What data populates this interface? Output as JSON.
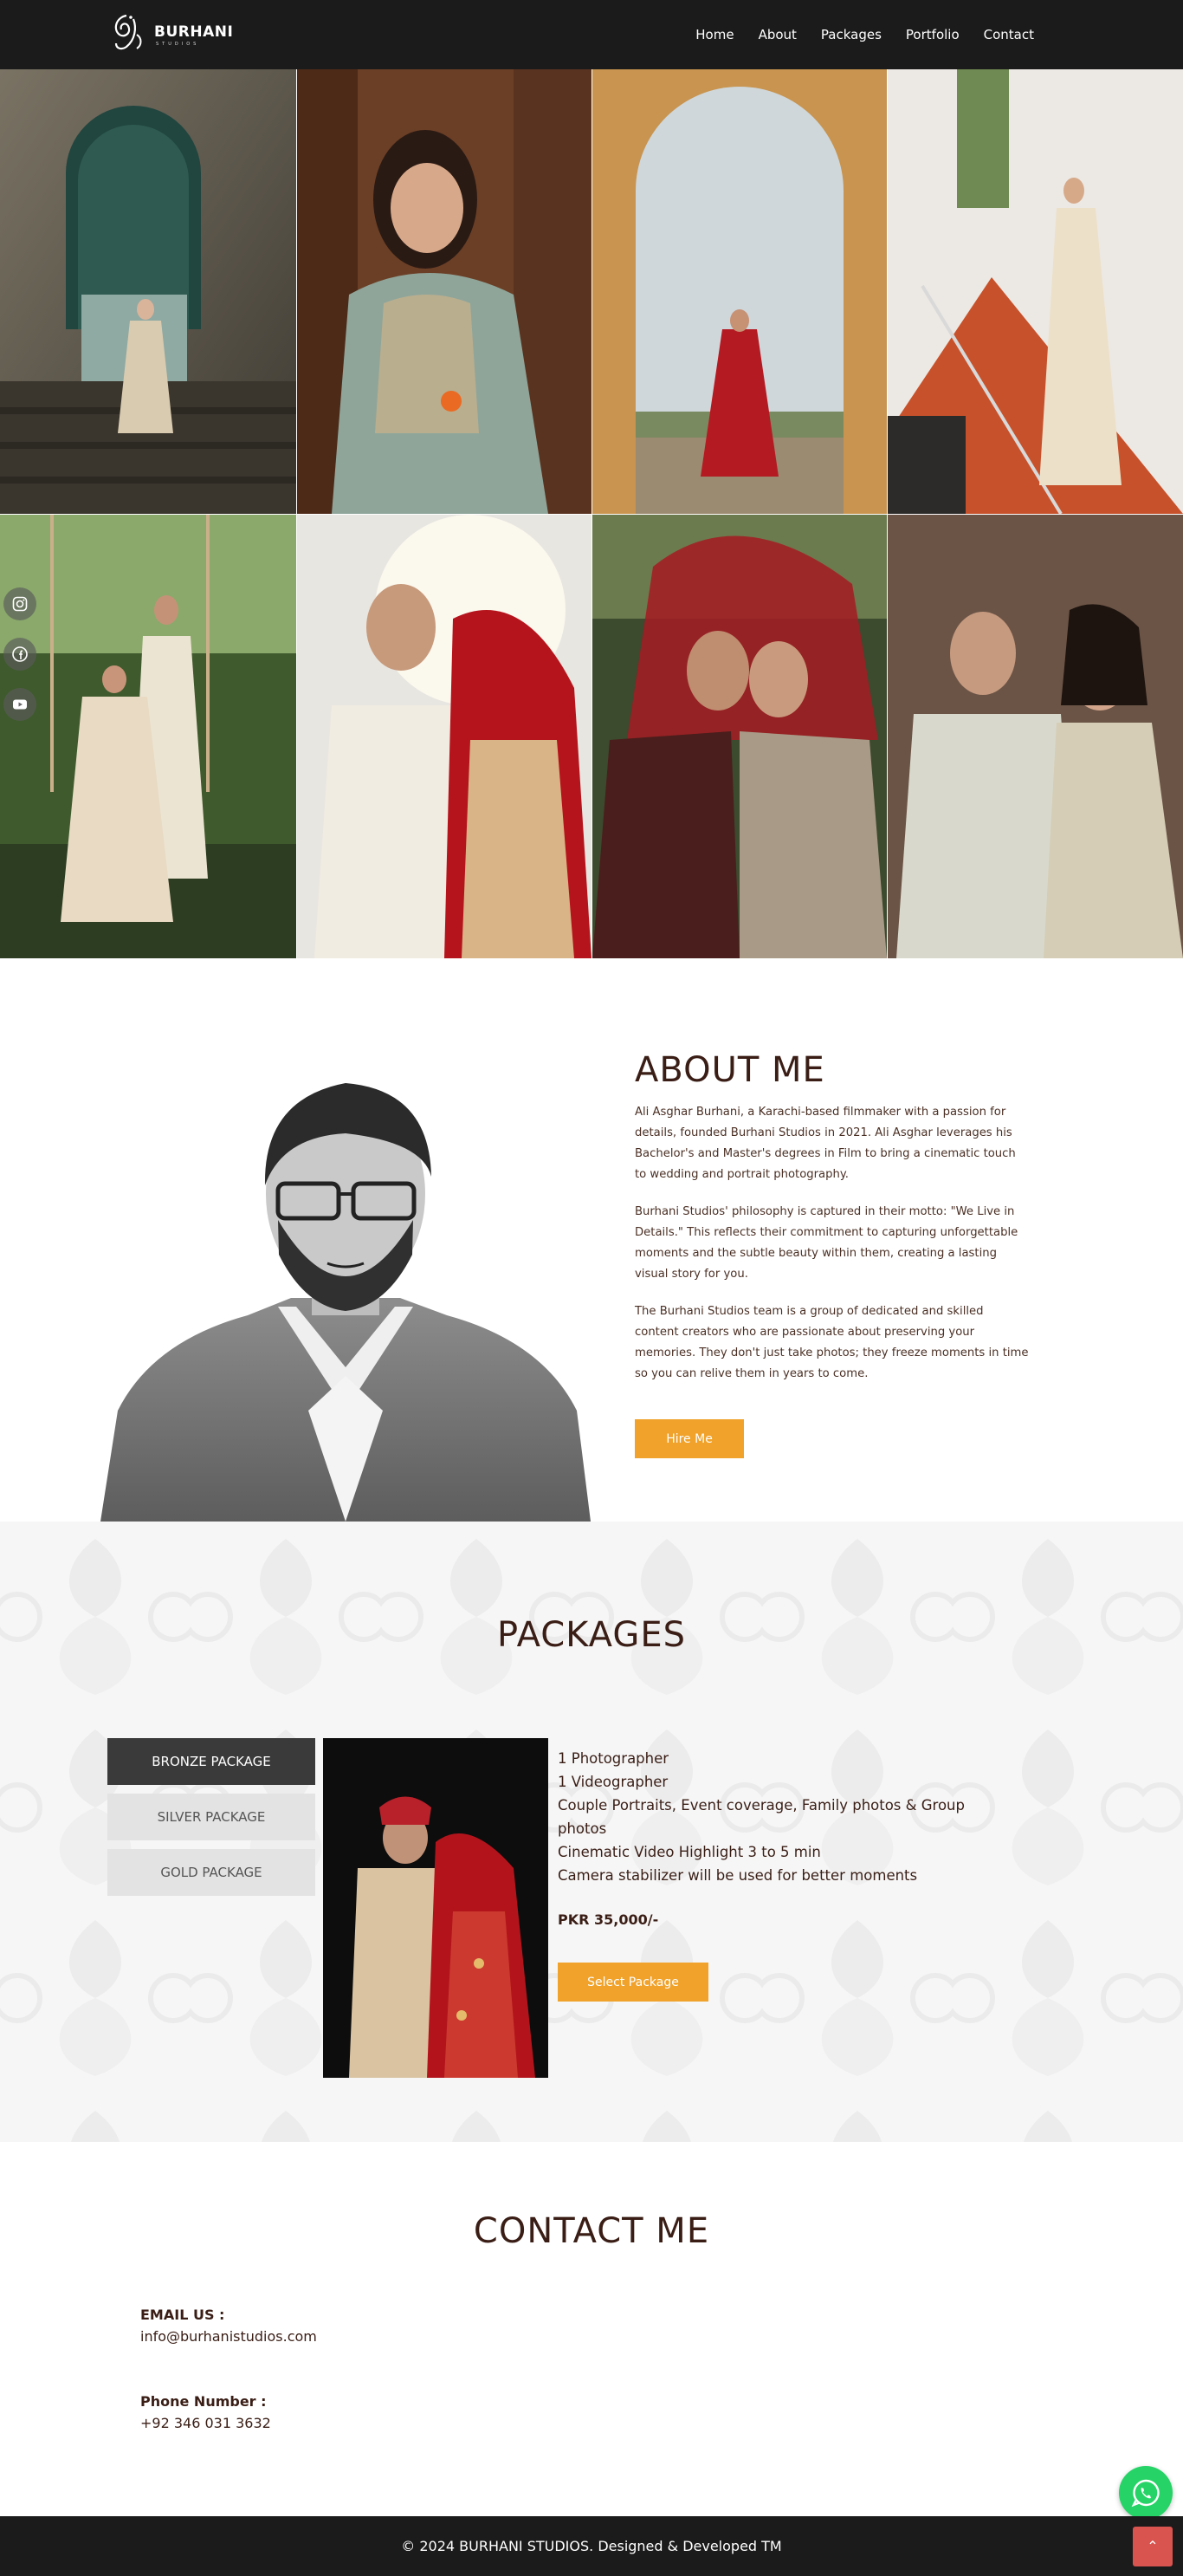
{
  "brand": {
    "name": "BURHANI",
    "sub": "STUDIOS"
  },
  "nav": {
    "items": [
      "Home",
      "About",
      "Packages",
      "Portfolio",
      "Contact"
    ]
  },
  "social": {
    "icons": [
      "instagram-icon",
      "facebook-icon",
      "youtube-icon"
    ]
  },
  "gallery": {
    "photos": [
      "Bride standing in front of a green arched doorway",
      "Bride smiling holding orange flowers",
      "Bride in red lehenga under a brick archway",
      "Bride in ivory dress on a staircase",
      "Couple on a swing in a garden",
      "Groom kissing bride's forehead in sunlight",
      "Couple under a red veil",
      "Couple smiling in front of a wooden door"
    ]
  },
  "about": {
    "title": "ABOUT ME",
    "paragraphs": [
      "Ali Asghar Burhani, a Karachi-based filmmaker with a passion for details, founded Burhani Studios in 2021. Ali Asghar leverages his Bachelor's and Master's degrees in Film to bring a cinematic touch to wedding and portrait photography.",
      "Burhani Studios' philosophy is captured in their motto: \"We Live in Details.\" This reflects their commitment to capturing unforgettable moments and the subtle beauty within them, creating a lasting visual story for you.",
      "The Burhani Studios team is a group of dedicated and skilled content creators who are passionate about preserving your memories. They don't just take photos; they freeze moments in time so you can relive them in years to come."
    ],
    "hire_label": "Hire Me"
  },
  "packages": {
    "title": "PACKAGES",
    "tabs": [
      "BRONZE PACKAGE",
      "SILVER PACKAGE",
      "GOLD PACKAGE"
    ],
    "active_tab": "BRONZE PACKAGE",
    "features": [
      "1 Photographer",
      "1 Videographer",
      "Couple Portraits, Event coverage, Family photos & Group photos",
      "Cinematic Video Highlight 3 to 5 min",
      "Camera stabilizer will be used for better moments"
    ],
    "price": "PKR 35,000/-",
    "select_label": "Select Package"
  },
  "contact": {
    "title": "CONTACT ME",
    "email_label": "EMAIL US :",
    "email": "info@burhanistudios.com",
    "phone_label": "Phone Number :",
    "phone": "+92 346 031 3632"
  },
  "footer": {
    "text": "© 2024 BURHANI STUDIOS. Designed & Developed TM"
  },
  "colors": {
    "accent": "#f0a22a",
    "dark": "#1b1b1b",
    "heading": "#3a1e16",
    "top_button": "#d9534f",
    "whatsapp": "#25d366"
  }
}
